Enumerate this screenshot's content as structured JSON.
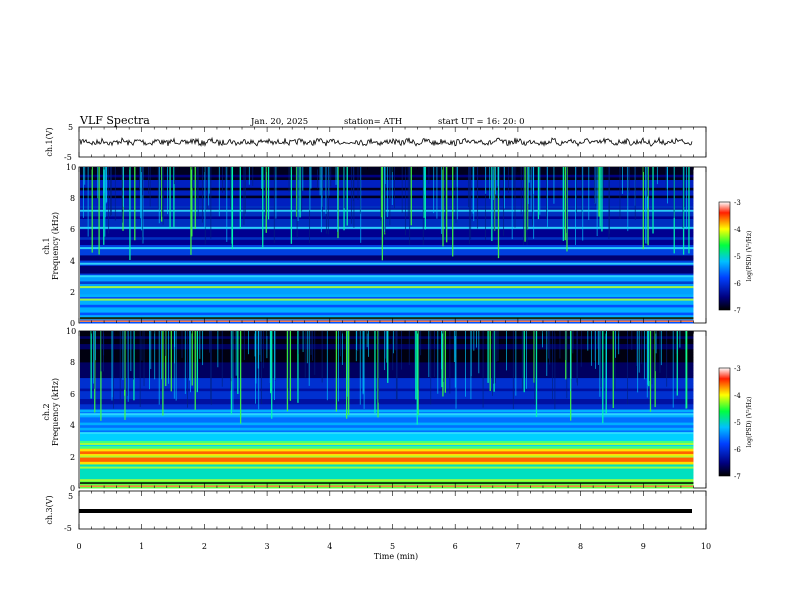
{
  "header": {
    "title": "VLF Spectra",
    "date": "Jan. 20, 2025",
    "station": "station= ATH",
    "start": "start  UT =   16: 20: 0"
  },
  "chart_data": [
    {
      "type": "line",
      "panel": "ch1-waveform",
      "ylabel": "ch.1(V)",
      "yticks": [
        "5",
        "-5"
      ],
      "ylim": [
        -5,
        5
      ],
      "xlim": [
        0,
        10
      ],
      "series": [
        {
          "values_description_only_in_script": true,
          "approx_level": -0.5
        }
      ]
    },
    {
      "type": "heatmap",
      "panel": "ch1-spectrogram",
      "ylabel_top": "ch.1",
      "ylabel": "Frequency  (kHz)",
      "yticks": [
        "0",
        "2",
        "4",
        "6",
        "8",
        "10"
      ],
      "ylim": [
        0,
        10
      ],
      "xlim": [
        0,
        9.8
      ],
      "colorbar": {
        "label": "log(PSD) (V²/Hz)",
        "range": [
          -7,
          -3
        ],
        "ticks": [
          "-3",
          "-4",
          "-5",
          "-6",
          "-7"
        ]
      },
      "bands_khz": [
        0.3,
        1.5,
        2.3,
        3.0,
        3.8,
        4.8,
        6.1,
        7.2
      ],
      "burst_times_min": [
        0.3,
        0.8,
        1.4,
        1.9,
        2.5,
        3.0,
        3.4,
        4.2,
        4.8,
        5.4,
        5.9,
        6.6,
        7.2,
        7.8,
        8.4,
        9.1,
        9.6
      ]
    },
    {
      "type": "heatmap",
      "panel": "ch2-spectrogram",
      "ylabel_top": "ch.2",
      "ylabel": "Frequency  (kHz)",
      "yticks": [
        "0",
        "2",
        "4",
        "6",
        "8",
        "10"
      ],
      "ylim": [
        0,
        10
      ],
      "xlim": [
        0,
        9.8
      ],
      "colorbar": {
        "label": "log(PSD) (V²/Hz)",
        "range": [
          -7,
          -3
        ],
        "ticks": [
          "-3",
          "-4",
          "-5",
          "-6",
          "-7"
        ]
      },
      "bands_khz": [
        0.5,
        1.3,
        2.0,
        2.8,
        3.5,
        4.7
      ],
      "burst_times_min": [
        0.3,
        0.8,
        1.4,
        1.9,
        2.5,
        3.0,
        3.4,
        4.2,
        4.8,
        5.4,
        5.9,
        6.6,
        7.2,
        7.8,
        8.4,
        9.1,
        9.6
      ]
    },
    {
      "type": "line",
      "panel": "ch3-waveform",
      "ylabel": "ch.3(V)",
      "yticks": [
        "5",
        "-5"
      ],
      "ylim": [
        -5,
        5
      ],
      "xlim": [
        0,
        10
      ],
      "series": [
        {
          "constant_level": -1.5
        }
      ]
    }
  ],
  "xaxis": {
    "label": "Time  (min)",
    "ticks": [
      "0",
      "1",
      "2",
      "3",
      "4",
      "5",
      "6",
      "7",
      "8",
      "9",
      "10"
    ],
    "range": [
      0,
      10
    ]
  }
}
